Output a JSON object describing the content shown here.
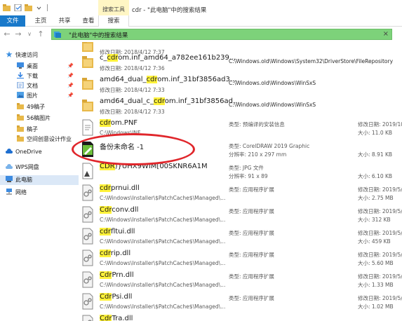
{
  "titlebar": {
    "context_tab": "搜索工具",
    "title": "cdr - \"此电脑\"中的搜索结果"
  },
  "ribbon": {
    "tabs": [
      "文件",
      "主页",
      "共享",
      "查看",
      "搜索"
    ]
  },
  "address": {
    "path": "\"此电脑\"中的搜索结果",
    "clear": "×"
  },
  "sidebar": {
    "items": [
      {
        "label": "快速访问",
        "icon": "star-icon"
      },
      {
        "label": "桌面",
        "icon": "desktop-icon",
        "pinned": true
      },
      {
        "label": "下载",
        "icon": "download-icon",
        "pinned": true
      },
      {
        "label": "文档",
        "icon": "document-icon",
        "pinned": true
      },
      {
        "label": "图片",
        "icon": "picture-icon",
        "pinned": true
      },
      {
        "label": "49稿子",
        "icon": "folder-icon"
      },
      {
        "label": "56稿图片",
        "icon": "folder-icon"
      },
      {
        "label": "稿子",
        "icon": "folder-icon"
      },
      {
        "label": "空间创意设计作业",
        "icon": "folder-icon"
      },
      {
        "label": "OneDrive",
        "icon": "cloud-icon"
      },
      {
        "label": "WPS网盘",
        "icon": "cloud-icon"
      },
      {
        "label": "此电脑",
        "icon": "computer-icon"
      },
      {
        "label": "网络",
        "icon": "network-icon"
      }
    ],
    "selected": "此电脑"
  },
  "files": [
    {
      "pre": "",
      "hl": "",
      "post": "",
      "sub": "修改日期: 2018/4/12 7:37",
      "path": "",
      "c1": "",
      "c1b": "",
      "c2": "",
      "c2b": "",
      "icon": "folder-icon"
    },
    {
      "pre": "c_",
      "hl": "cdr",
      "post": "om.inf_amd64_a782ee161b239...",
      "sub": "修改日期: 2018/4/12 7:36",
      "path": "C:\\Windows.old\\Windows\\System32\\DriverStore\\FileRepository",
      "c1": "",
      "c1b": "",
      "c2": "",
      "c2b": "",
      "icon": "folder-icon"
    },
    {
      "pre": "amd64_dual_",
      "hl": "cdr",
      "post": "om.inf_31bf3856ad3...",
      "sub": "修改日期: 2018/4/12 7:33",
      "path": "C:\\Windows.old\\Windows\\WinSxS",
      "c1": "",
      "c1b": "",
      "c2": "",
      "c2b": "",
      "icon": "folder-icon"
    },
    {
      "pre": "amd64_dual_c_",
      "hl": "cdr",
      "post": "om.inf_31bf3856ad...",
      "sub": "修改日期: 2018/4/12 7:33",
      "path": "C:\\Windows.old\\Windows\\WinSxS",
      "c1": "",
      "c1b": "",
      "c2": "",
      "c2b": "",
      "icon": "folder-icon"
    },
    {
      "pre": "",
      "hl": "cdr",
      "post": "om.PNF",
      "sub": "C:\\Windows\\INF",
      "path": "",
      "c1": "类型: 预编译的安装信息",
      "c1b": "",
      "c2": "修改日期: 2019/10",
      "c2b": "大小: 11.0 KB",
      "icon": "file-icon"
    },
    {
      "pre": "备份未命名 -1",
      "hl": "",
      "post": "",
      "sub": "",
      "path": "",
      "c1": "类型: CorelDRAW 2019 Graphic",
      "c1b": "分辨率: 210 x 297 mm",
      "c2": "",
      "c2b": "大小: 8.91 KB",
      "icon": "coreldraw-icon"
    },
    {
      "pre": "",
      "hl": "CDR",
      "post": ")}UHX9WIM[00SKNR6A1M",
      "sub": "",
      "path": "",
      "c1": "类型: JPG 文件",
      "c1b": "分辨率: 91 x 89",
      "c2": "",
      "c2b": "大小: 6.10 KB",
      "icon": "image-file-icon"
    },
    {
      "pre": "",
      "hl": "cdr",
      "post": "prnui.dll",
      "sub": "C:\\Windows\\Installer\\$PatchCache$\\Managed\\...",
      "path": "",
      "c1": "类型: 应用程序扩展",
      "c1b": "",
      "c2": "修改日期: 2019/5/",
      "c2b": "大小: 2.75 MB",
      "icon": "dll-icon"
    },
    {
      "pre": "",
      "hl": "Cdr",
      "post": "conv.dll",
      "sub": "C:\\Windows\\Installer\\$PatchCache$\\Managed\\...",
      "path": "",
      "c1": "类型: 应用程序扩展",
      "c1b": "",
      "c2": "修改日期: 2019/5/",
      "c2b": "大小: 312 KB",
      "icon": "dll-icon"
    },
    {
      "pre": "",
      "hl": "cdr",
      "post": "fltui.dll",
      "sub": "C:\\Windows\\Installer\\$PatchCache$\\Managed\\...",
      "path": "",
      "c1": "类型: 应用程序扩展",
      "c1b": "",
      "c2": "修改日期: 2019/5/",
      "c2b": "大小: 459 KB",
      "icon": "dll-icon"
    },
    {
      "pre": "",
      "hl": "cdr",
      "post": "rip.dll",
      "sub": "C:\\Windows\\Installer\\$PatchCache$\\Managed\\...",
      "path": "",
      "c1": "类型: 应用程序扩展",
      "c1b": "",
      "c2": "修改日期: 2019/5/",
      "c2b": "大小: 5.60 MB",
      "icon": "dll-icon"
    },
    {
      "pre": "",
      "hl": "Cdr",
      "post": "Prn.dll",
      "sub": "C:\\Windows\\Installer\\$PatchCache$\\Managed\\...",
      "path": "",
      "c1": "类型: 应用程序扩展",
      "c1b": "",
      "c2": "修改日期: 2019/5/",
      "c2b": "大小: 1.33 MB",
      "icon": "dll-icon"
    },
    {
      "pre": "",
      "hl": "Cdr",
      "post": "Psi.dll",
      "sub": "C:\\Windows\\Installer\\$PatchCache$\\Managed\\...",
      "path": "",
      "c1": "类型: 应用程序扩展",
      "c1b": "",
      "c2": "修改日期: 2019/5/",
      "c2b": "大小: 1.02 MB",
      "icon": "dll-icon"
    },
    {
      "pre": "",
      "hl": "Cdr",
      "post": "Tra.dll",
      "sub": "",
      "path": "",
      "c1": "",
      "c1b": "",
      "c2": "",
      "c2b": "",
      "icon": "dll-icon"
    }
  ],
  "colors": {
    "accent": "#1979ca",
    "address_bar": "#7dd27a",
    "highlight": "#fff23a",
    "annotation": "#e0262b",
    "context_tab": "#fff6c4"
  }
}
